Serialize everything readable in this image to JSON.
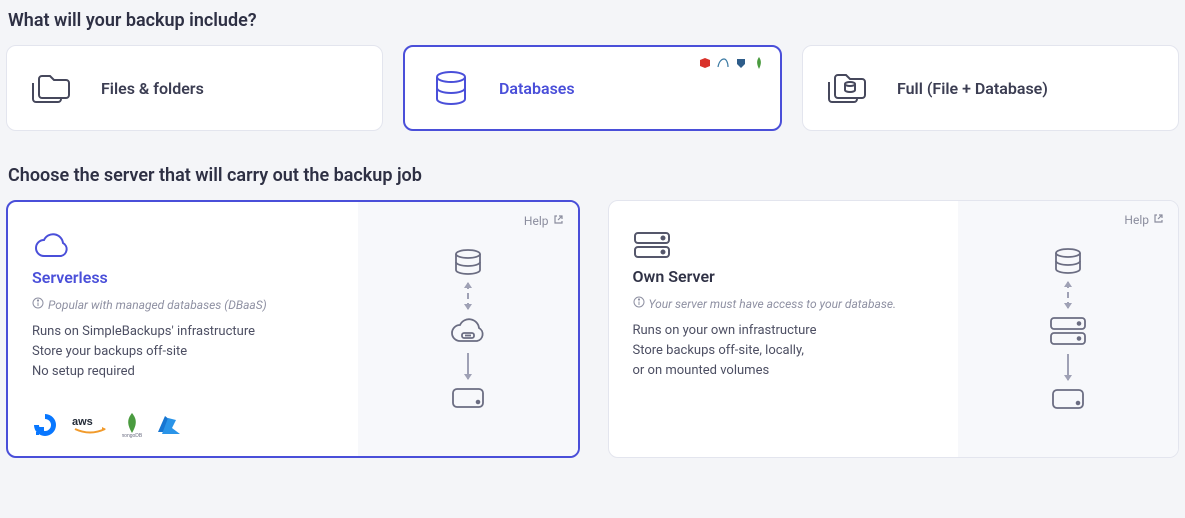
{
  "section1": {
    "title": "What will your backup include?",
    "options": [
      {
        "label": "Files & folders"
      },
      {
        "label": "Databases"
      },
      {
        "label": "Full (File + Database)"
      }
    ]
  },
  "section2": {
    "title": "Choose the server that will carry out the backup job",
    "help": "Help",
    "serverless": {
      "title": "Serverless",
      "note": "Popular with managed databases (DBaaS)",
      "line1": "Runs on SimpleBackups' infrastructure",
      "line2": "Store your backups off-site",
      "line3": "No setup required"
    },
    "own": {
      "title": "Own Server",
      "note": "Your server must have access to your database.",
      "line1": "Runs on your own infrastructure",
      "line2": "Store backups off-site, locally,",
      "line3": "or on mounted volumes"
    }
  }
}
